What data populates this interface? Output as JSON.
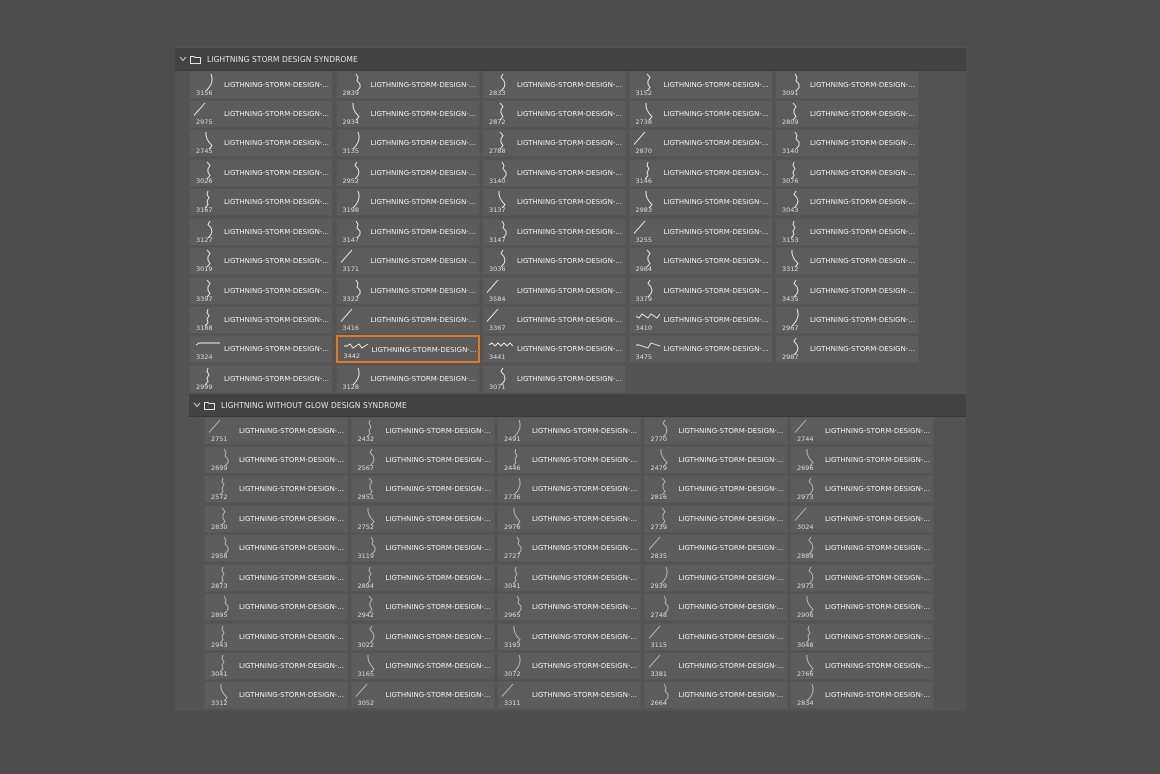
{
  "colors": {
    "background": "#4d4d4d",
    "panel": "#535353",
    "cell": "#5c5c5c",
    "header": "#424242",
    "selection": "#e07b21"
  },
  "groups": [
    {
      "title": "LIGHTNING STORM DESIGN SYNDROME",
      "expand_icon": "chevron-down-icon",
      "folder_icon": "folder-icon",
      "item_label": "LIGTHNING-STORM-DESIGN-...",
      "selected_index": 46,
      "items": [
        "3156",
        "2839",
        "2833",
        "3152",
        "3091",
        "2975",
        "2934",
        "2872",
        "2738",
        "2809",
        "2745",
        "3135",
        "2788",
        "2870",
        "3140",
        "3026",
        "2952",
        "3140",
        "3146",
        "3076",
        "3167",
        "3198",
        "3137",
        "2983",
        "3043",
        "3127",
        "3147",
        "3147",
        "3255",
        "3153",
        "3019",
        "3171",
        "3036",
        "2984",
        "3312",
        "3397",
        "3322",
        "3584",
        "3379",
        "3435",
        "3188",
        "3416",
        "3367",
        "3410",
        "2967",
        "3324",
        "3442",
        "3441",
        "3475",
        "2987",
        "2999",
        "3128",
        "3071"
      ]
    },
    {
      "title": "LIGHTNING WITHOUT GLOW DESIGN SYNDROME",
      "expand_icon": "chevron-down-icon",
      "folder_icon": "folder-icon",
      "item_label": "LIGTHNING-STORM-DESIGN-...",
      "selected_index": -1,
      "items": [
        "2751",
        "2432",
        "2491",
        "2770",
        "2744",
        "2699",
        "2567",
        "2446",
        "2479",
        "2696",
        "2572",
        "2851",
        "2736",
        "2816",
        "2973",
        "2830",
        "2752",
        "2976",
        "2739",
        "3024",
        "2958",
        "3119",
        "2727",
        "2835",
        "2889",
        "2873",
        "2894",
        "3041",
        "2939",
        "2973",
        "2895",
        "2942",
        "2965",
        "2748",
        "2906",
        "2943",
        "3022",
        "3193",
        "3115",
        "3048",
        "3041",
        "3165",
        "3072",
        "3381",
        "2766",
        "3312",
        "3052",
        "3311",
        "2664",
        "2834"
      ]
    }
  ]
}
